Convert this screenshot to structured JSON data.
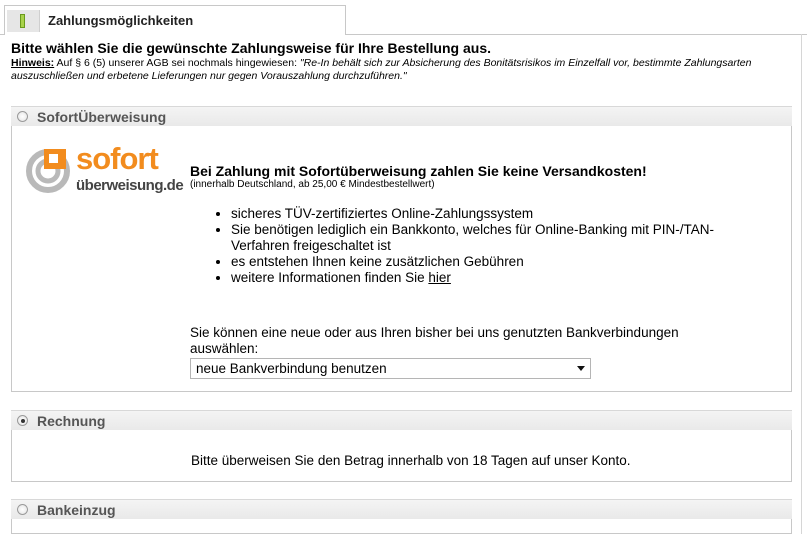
{
  "tab": {
    "title": "Zahlungsmöglichkeiten"
  },
  "intro": {
    "title": "Bitte wählen Sie die gewünschte Zahlungsweise für Ihre Bestellung aus.",
    "notice_label": "Hinweis:",
    "notice_text": " Auf § 6 (5) unserer AGB sei nochmals hingewiesen: ",
    "notice_quote": "\"Re-In behält sich zur Absicherung des Bonitätsrisikos im Einzelfall vor, bestimmte Zahlungsarten auszuschließen und erbetene Lieferungen nur gegen Vorauszahlung durchzuführen.\""
  },
  "sections": {
    "sofort": {
      "label": "SofortÜberweisung",
      "selected": false,
      "logo_main": "sofort",
      "logo_sub": "überweisung.de",
      "headline": "Bei Zahlung mit Sofortüberweisung zahlen Sie keine Versandkosten!",
      "subline": "(innerhalb Deutschland, ab 25,00 € Mindestbestellwert)",
      "bullets": [
        "sicheres TÜV-zertifiziertes Online-Zahlungssystem",
        "Sie benötigen lediglich ein Bankkonto, welches für Online-Banking mit PIN-/TAN-Verfahren freigeschaltet ist",
        "es entstehen Ihnen keine zusätzlichen Gebühren"
      ],
      "info_prefix": "weitere Informationen finden Sie ",
      "info_link": "hier",
      "bank_choice_text": "Sie können eine neue oder aus Ihren bisher bei uns genutzten Bankverbindungen auswählen:",
      "bank_select_value": "neue Bankverbindung benutzen"
    },
    "rechnung": {
      "label": "Rechnung",
      "selected": true,
      "text": "Bitte überweisen Sie den Betrag innerhalb von 18 Tagen auf unser Konto."
    },
    "bankeinzug": {
      "label": "Bankeinzug",
      "selected": false
    }
  },
  "colors": {
    "accent": "#f28c1e",
    "tab_marker": "#a8d24a"
  }
}
